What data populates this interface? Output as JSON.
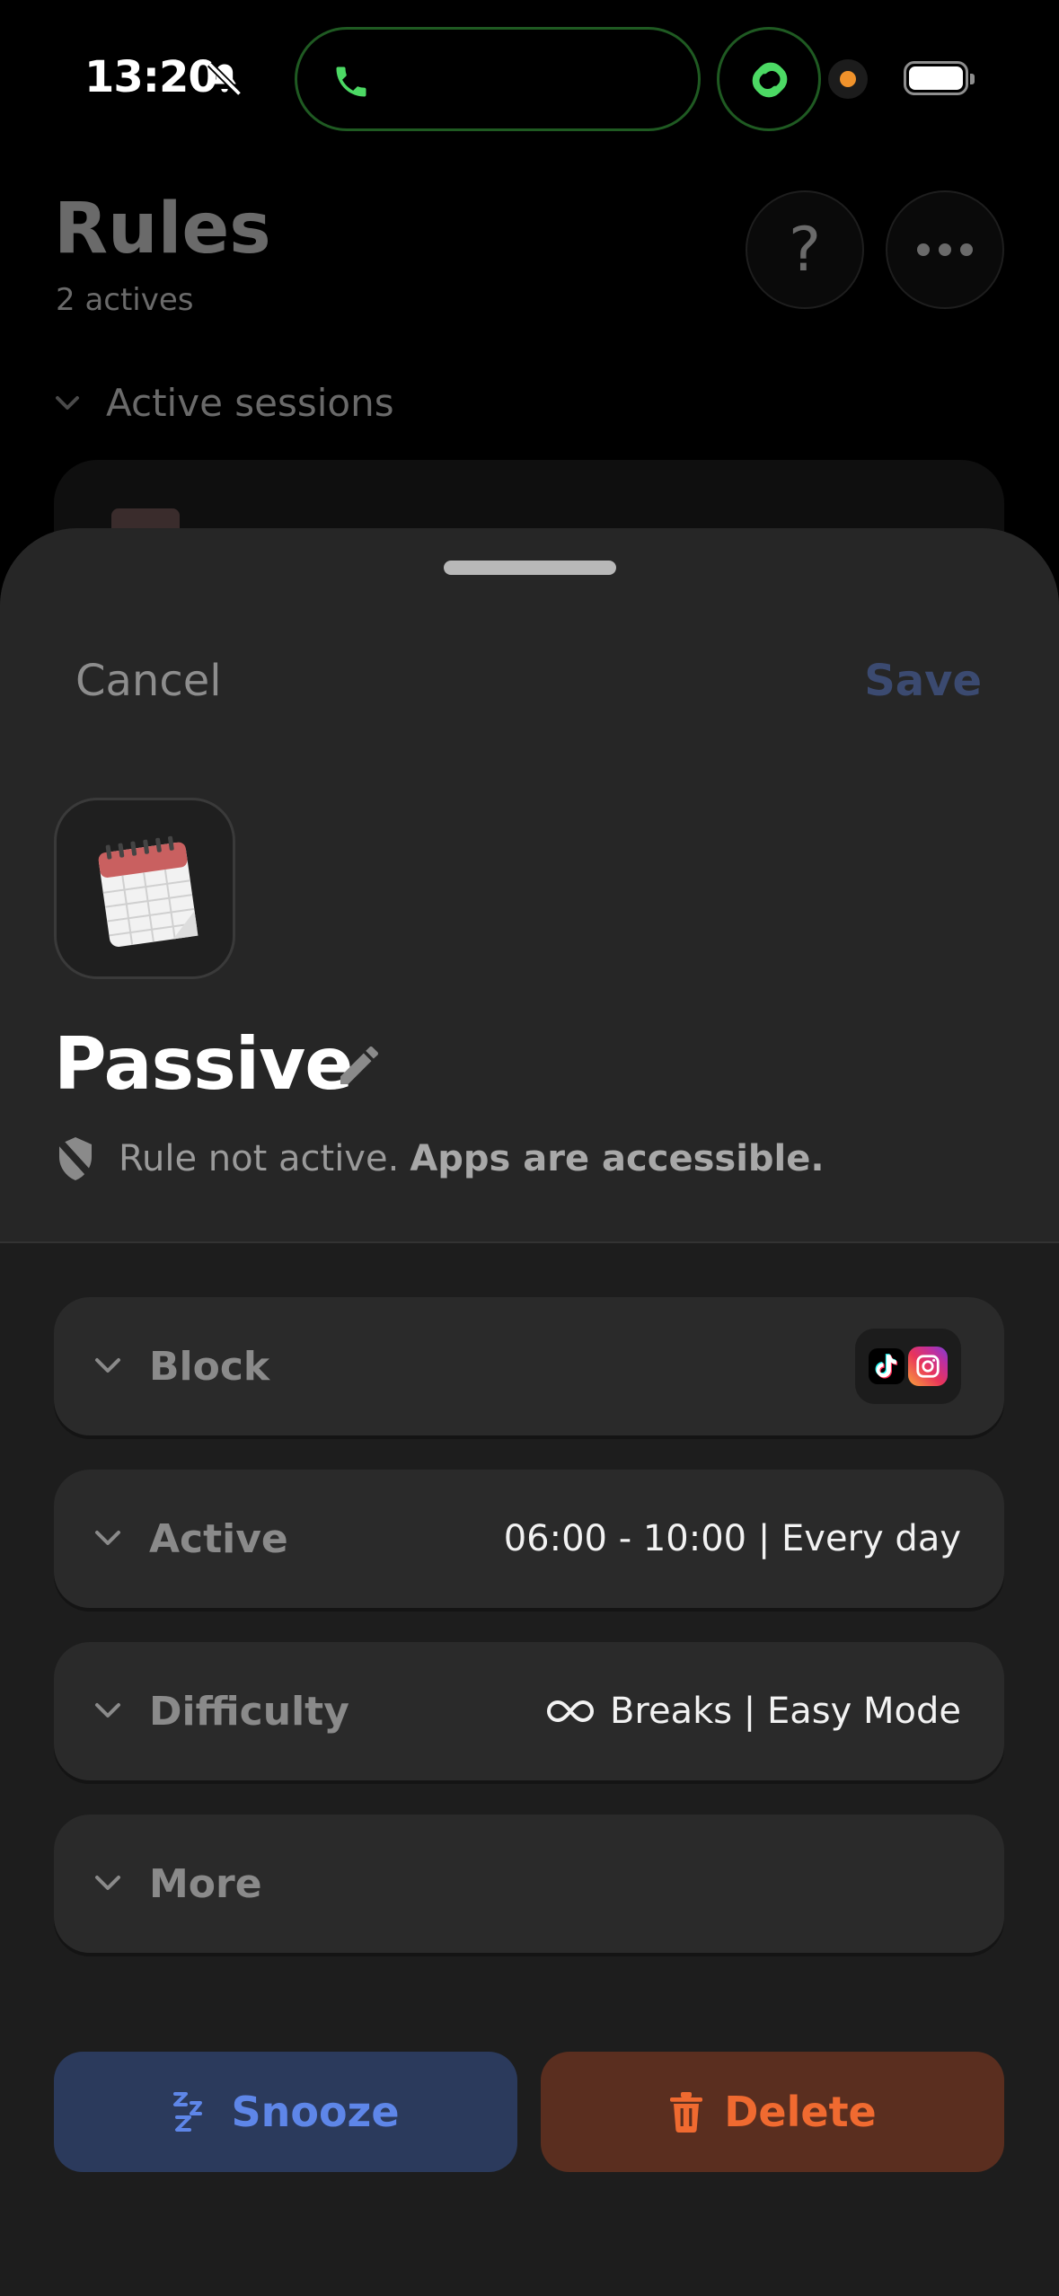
{
  "status_bar": {
    "time": "13:20",
    "icons": [
      "bell-slash-icon",
      "phone-icon",
      "link-icon",
      "privacy-indicator-dot",
      "battery-icon"
    ],
    "accent_green": "#4cd964",
    "dot_color": "#f0922b"
  },
  "background_screen": {
    "title": "Rules",
    "subtitle": "2 actives",
    "section_label": "Active sessions",
    "help_label": "?"
  },
  "sheet": {
    "cancel_label": "Cancel",
    "save_label": "Save",
    "rule_icon": "notepad-icon",
    "rule_name": "Passive",
    "status_text": "Rule not active.",
    "status_strong": "Apps are accessible.",
    "rows": [
      {
        "label": "Block",
        "value": "",
        "apps": [
          "tiktok-icon",
          "instagram-icon"
        ]
      },
      {
        "label": "Active",
        "value": "06:00 - 10:00 | Every day"
      },
      {
        "label": "Difficulty",
        "value": "Breaks | Easy Mode",
        "icon": "infinity-icon"
      },
      {
        "label": "More",
        "value": ""
      }
    ],
    "snooze_label": "Snooze",
    "delete_label": "Delete",
    "colors": {
      "snooze_bg": "#2b3a5c",
      "snooze_fg": "#5e86e8",
      "delete_bg": "#5a2e1f",
      "delete_fg": "#f06a30"
    }
  }
}
